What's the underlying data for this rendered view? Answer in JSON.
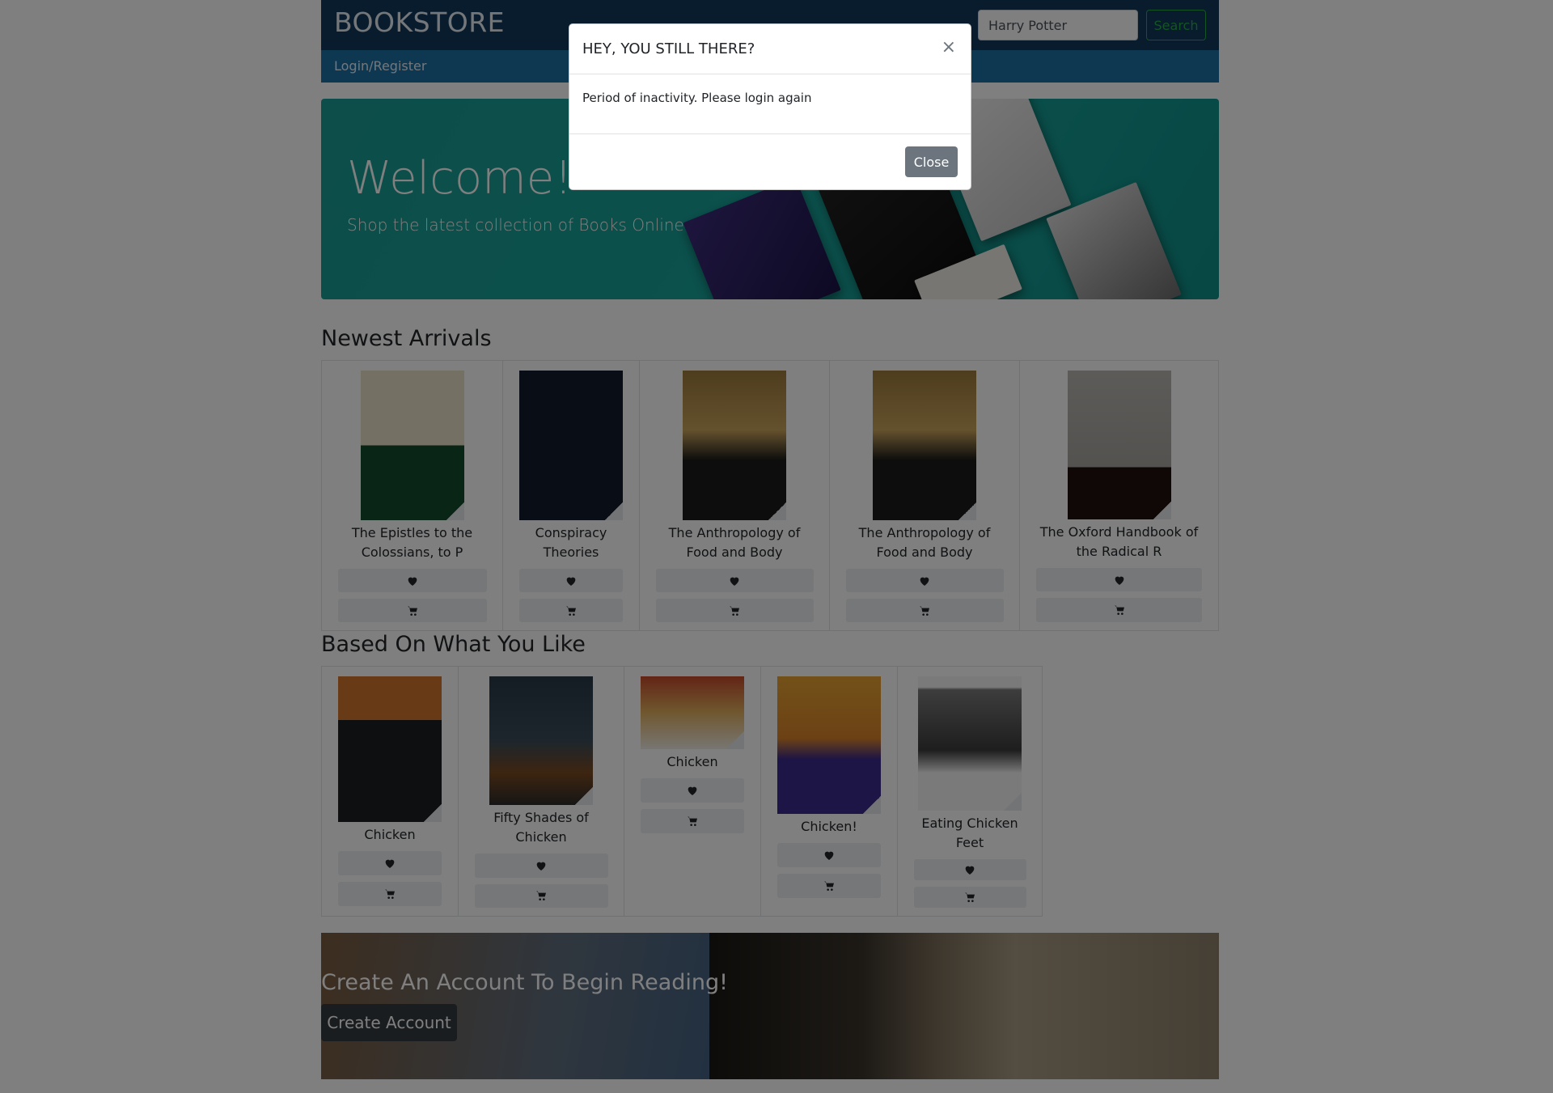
{
  "header": {
    "brand": "BOOKSTORE",
    "search_value": "Harry Potter",
    "search_button": "Search",
    "login_link": "Login/Register"
  },
  "hero": {
    "title": "Welcome!",
    "subtitle": "Shop the latest collection of Books Online."
  },
  "newest": {
    "title": "Newest Arrivals",
    "books": [
      {
        "title": "The Epistles to the Colossians, to P"
      },
      {
        "title": "Conspiracy Theories"
      },
      {
        "title": "The Anthropology of Food and Body"
      },
      {
        "title": "The Anthropology of Food and Body"
      },
      {
        "title": "The Oxford Handbook of the Radical R"
      }
    ]
  },
  "liked": {
    "title": "Based On What You Like",
    "books": [
      {
        "title": "Chicken"
      },
      {
        "title": "Fifty Shades of Chicken"
      },
      {
        "title": "Chicken"
      },
      {
        "title": "Chicken!"
      },
      {
        "title": "Eating Chicken Feet"
      }
    ]
  },
  "banner": {
    "title": "Create An Account To Begin Reading!",
    "button": "Create Account"
  },
  "modal": {
    "title": "HEY, YOU STILL THERE?",
    "close_x": "×",
    "body": "Period of inactivity. Please login again",
    "close_button": "Close"
  },
  "icons": {
    "wishlist": "heart-icon",
    "cart": "cart-icon"
  },
  "colors": {
    "header_dark": "#10385c",
    "header_light": "#1c6ea4",
    "hero_teal": "#17a39a",
    "search_green": "#28a745",
    "modal_button": "#6c757d"
  }
}
